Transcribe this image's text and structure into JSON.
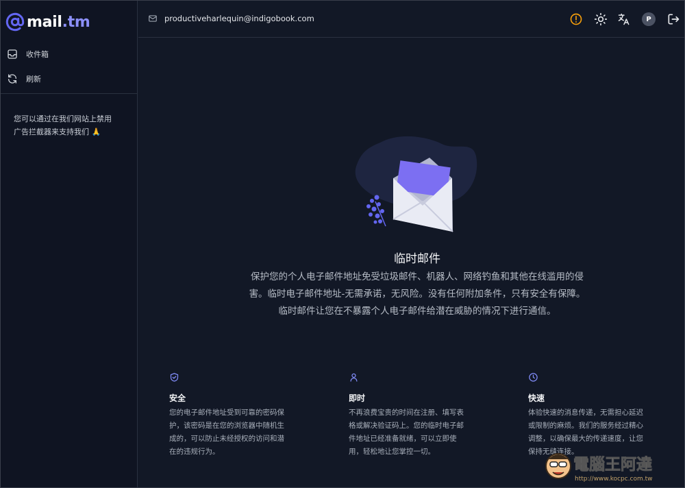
{
  "app": {
    "logo_name": "mail",
    "logo_tld": ".tm",
    "brand_color": "#6366f1"
  },
  "sidebar": {
    "items": [
      {
        "label": "收件箱",
        "icon": "inbox-icon"
      },
      {
        "label": "刷新",
        "icon": "refresh-icon"
      }
    ],
    "promo_line1": "您可以通过在我们网站上禁用",
    "promo_line2": "广告拦截器来支持我们 🙏"
  },
  "header": {
    "email": "productiveharlequin@indigobook.com",
    "icons": [
      "warning-icon",
      "sun-icon",
      "translate-icon",
      "avatar",
      "logout-icon"
    ],
    "avatar_letter": "P",
    "warning_color": "#f59e0b"
  },
  "hero": {
    "title": "临时邮件",
    "desc_line1": "保护您的个人电子邮件地址免受垃圾邮件、机器人、网络钓鱼和其他在线滥用的侵",
    "desc_line2": "害。临时电子邮件地址-无需承诺，无风险。没有任何附加条件，只有安全有保障。",
    "desc_line3": "临时邮件让您在不暴露个人电子邮件给潜在威胁的情况下进行通信。"
  },
  "features": [
    {
      "icon": "shield-icon",
      "title": "安全",
      "lines": [
        "您的电子邮件地址受到可靠的密码保",
        "护，该密码是在您的浏览器中随机生",
        "成的，可以防止未经授权的访问和潜",
        "在的违规行为。"
      ]
    },
    {
      "icon": "user-icon",
      "title": "即时",
      "lines": [
        "不再浪费宝贵的时间在注册、填写表",
        "格或解决验证码上。您的临时电子邮",
        "件地址已经准备就绪，可以立即使",
        "用，轻松地让您掌控一切。"
      ]
    },
    {
      "icon": "clock-icon",
      "title": "快速",
      "lines": [
        "体验快速的消息传递，无需担心延迟",
        "或限制的麻烦。我们的服务经过精心",
        "调整，以确保最大的传递速度，让您",
        "保持无缝连接。"
      ]
    }
  ],
  "watermark": {
    "name": "電腦王阿達",
    "url": "http://www.kocpc.com.tw"
  }
}
